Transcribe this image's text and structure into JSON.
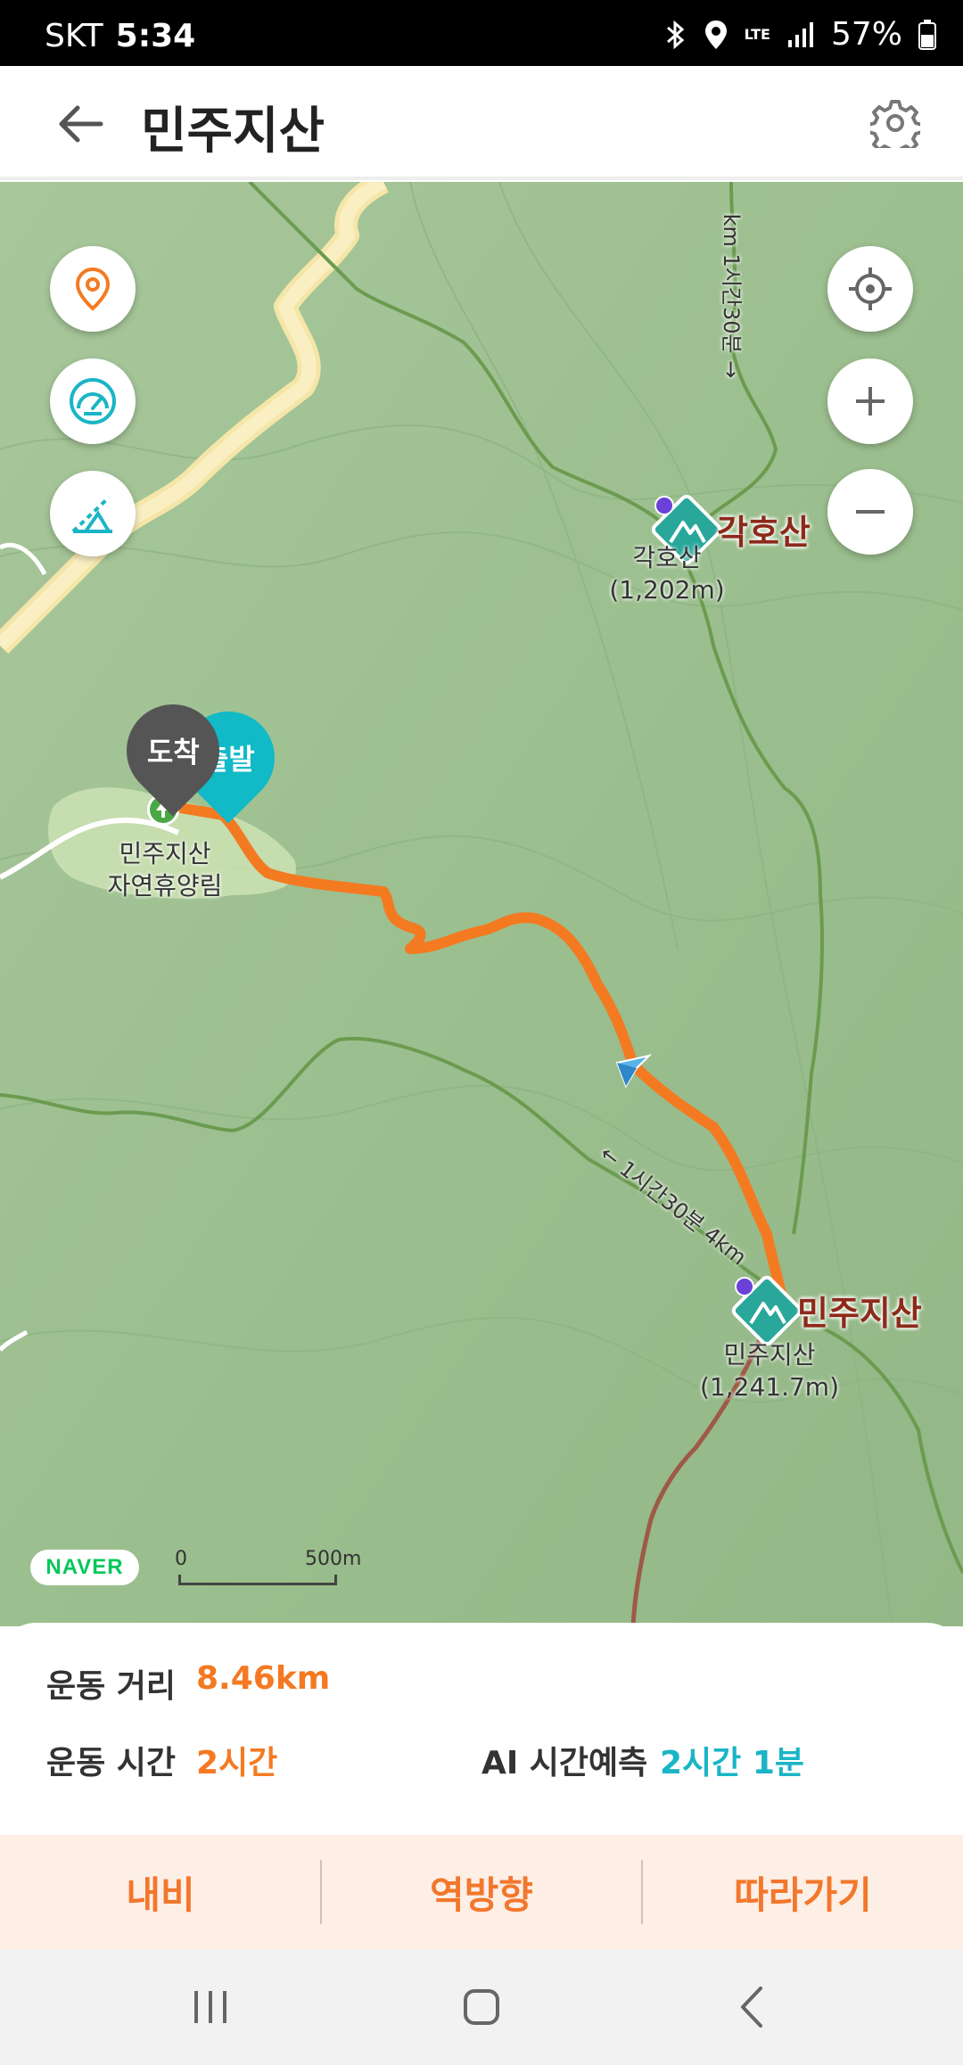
{
  "status": {
    "carrier": "SKT",
    "time": "5:34",
    "network": "LTE",
    "battery": "57%"
  },
  "header": {
    "title": "민주지산",
    "back_icon": "arrow-left-icon",
    "settings_icon": "gear-icon"
  },
  "map": {
    "left_buttons": [
      "location-pin-icon",
      "speedometer-icon",
      "elevation-icon"
    ],
    "right_buttons": [
      "current-location-icon",
      "zoom-in-icon",
      "zoom-out-icon"
    ],
    "pins": {
      "arrival": "도착",
      "departure": "출발"
    },
    "labels": {
      "forest_name_line1": "민주지산",
      "forest_name_line2": "자연휴양림",
      "peak1_name": "각호산",
      "peak1_label_line1": "각호산",
      "peak1_label_line2": "(1,202m)",
      "peak2_name": "민주지산",
      "peak2_label_line1": "민주지산",
      "peak2_label_line2": "(1,241.7m)",
      "trail_top": "km 1시간30분 →",
      "trail_mid": "← 1시간30분 4km"
    },
    "naver_logo": "NAVER",
    "scale": {
      "start": "0",
      "end": "500m"
    },
    "colors": {
      "route": "#f47a22",
      "arrival_pin": "#555555",
      "departure_pin": "#12b9c7",
      "peak_marker": "#2aa79b"
    }
  },
  "stats": {
    "distance_label": "운동 거리",
    "distance_value": "8.46km",
    "time_label": "운동 시간",
    "time_value": "2시간",
    "ai_label": "AI 시간예측",
    "ai_value": "2시간 1분",
    "orange": "#f47a22",
    "teal": "#1ab5c6"
  },
  "actions": {
    "nav_label": "내비",
    "reverse_label": "역방향",
    "follow_label": "따라가기"
  }
}
